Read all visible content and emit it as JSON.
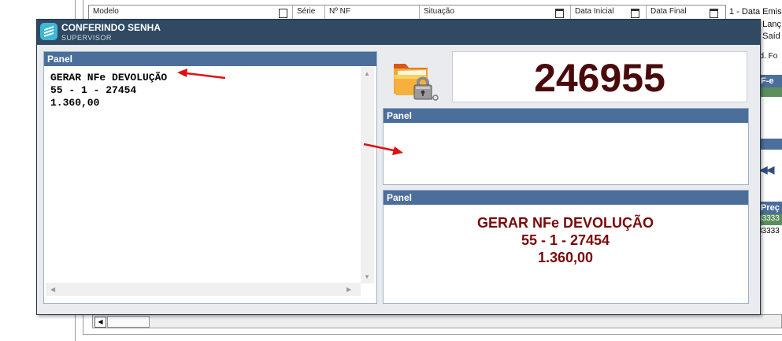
{
  "background": {
    "columns": [
      "Modelo",
      "Série",
      "Nº NF",
      "Situação",
      "Data Inicial",
      "Data Final"
    ],
    "right_items": [
      "1 - Data Emis",
      "o Lanç",
      "o Saíd",
      "ad. Fo"
    ],
    "right_panel": {
      "header": "F-e",
      "grid_header": "Preç",
      "rows": [
        "33333",
        "33333"
      ]
    }
  },
  "dialog": {
    "title": "CONFERINDO SENHA",
    "subtitle": "SUPERVISOR",
    "left_panel": {
      "header": "Panel",
      "lines": [
        "GERAR NFe DEVOLUÇÃO",
        "55 - 1 - 27454",
        "1.360,00"
      ]
    },
    "counter": "246955",
    "middle_panel": {
      "header": "Panel"
    },
    "bottom_panel": {
      "header": "Panel",
      "lines": [
        "GERAR NFe DEVOLUÇÃO",
        "55 - 1 - 27454",
        "1.360,00"
      ]
    }
  },
  "icons": {
    "app": "app-icon",
    "folder_lock": "folder-lock-icon",
    "annotation": "red-arrow-icon"
  },
  "colors": {
    "titlebar": "#2f4a62",
    "panel_header": "#4b6e9b",
    "counter": "#4a0a0a",
    "message": "#7a0a0a",
    "annotation": "#e01010"
  }
}
